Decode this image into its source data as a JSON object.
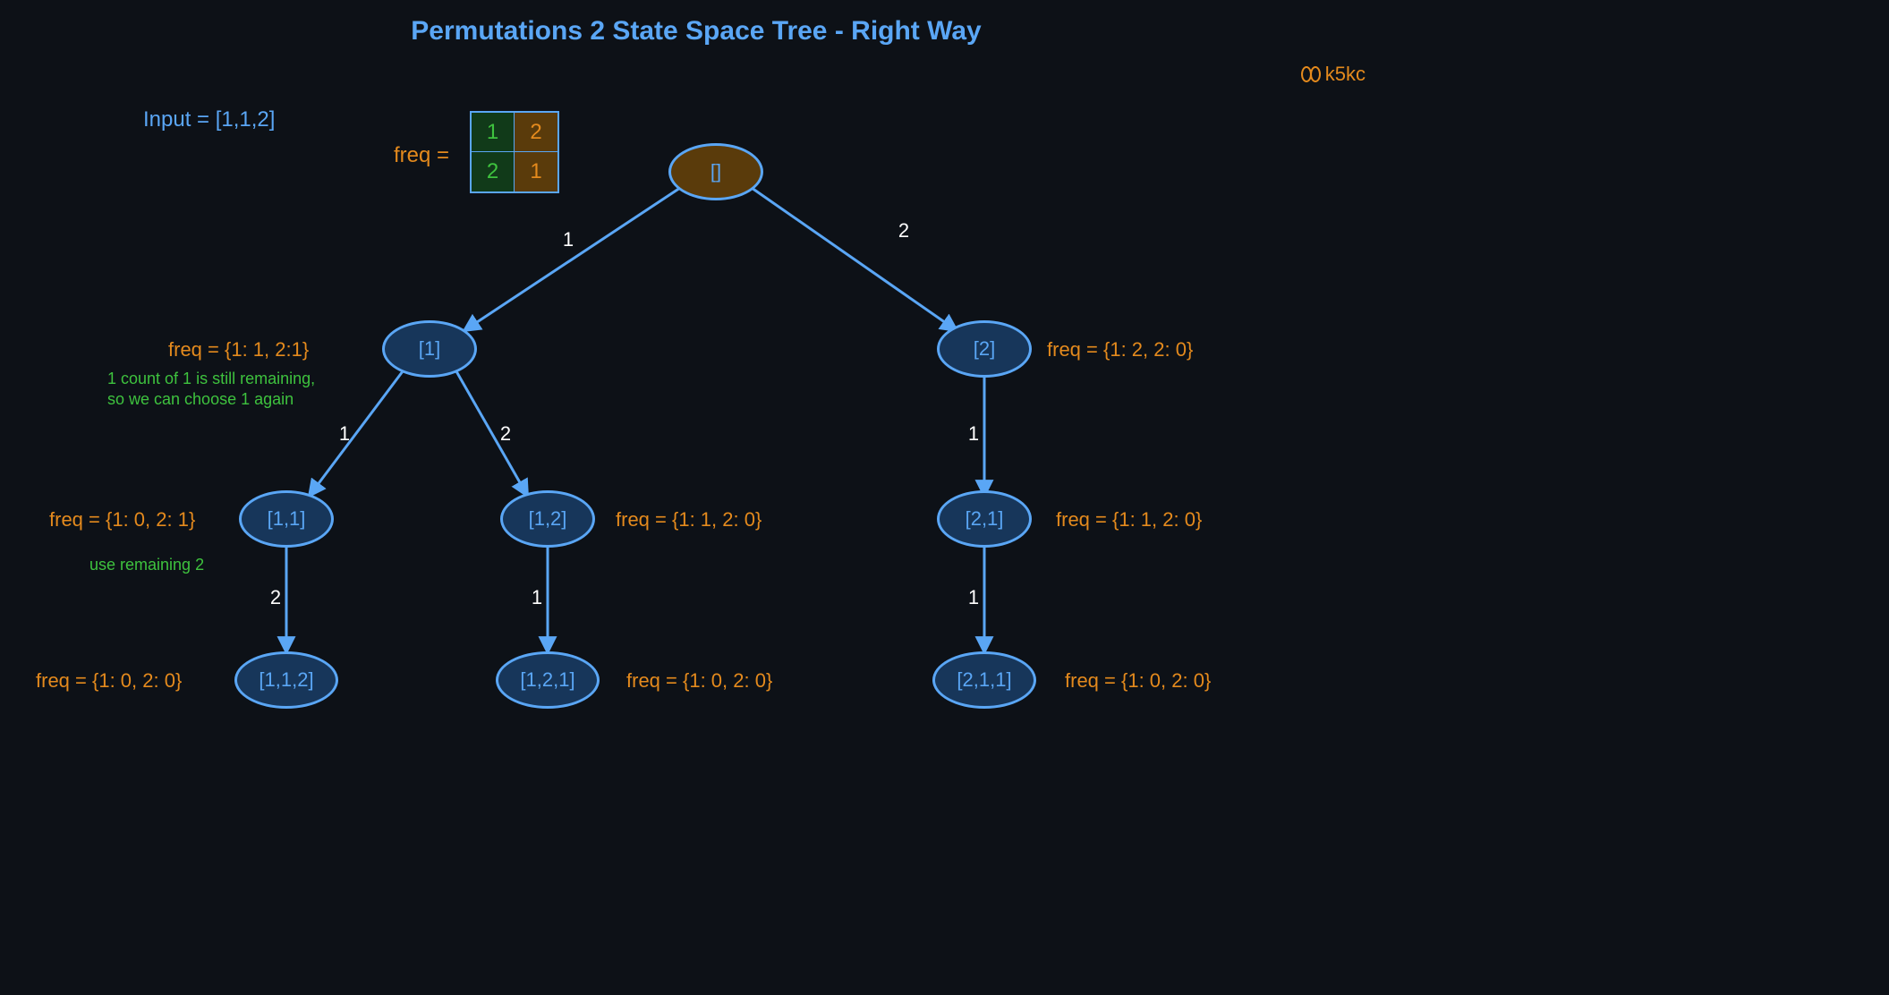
{
  "title": "Permutations 2 State Space Tree - Right Way",
  "watermark": "k5kc",
  "input_text": "Input = [1,1,2]",
  "freq_label": "freq =",
  "freq_table": {
    "tl": "1",
    "tr": "2",
    "bl": "2",
    "br": "1"
  },
  "nodes": {
    "root": {
      "label": "[]"
    },
    "n1": {
      "label": "[1]"
    },
    "n2": {
      "label": "[2]"
    },
    "n11": {
      "label": "[1,1]"
    },
    "n12": {
      "label": "[1,2]"
    },
    "n21": {
      "label": "[2,1]"
    },
    "n112": {
      "label": "[1,1,2]"
    },
    "n121": {
      "label": "[1,2,1]"
    },
    "n211": {
      "label": "[2,1,1]"
    }
  },
  "edges": {
    "root_n1": "1",
    "root_n2": "2",
    "n1_n11": "1",
    "n1_n12": "2",
    "n2_n21": "1",
    "n11_n112": "2",
    "n12_n121": "1",
    "n21_n211": "1"
  },
  "annotations": {
    "n1_freq": "freq = {1: 1, 2:1}",
    "n1_note": "1 count of 1 is still remaining,\nso we can choose 1 again",
    "n2_freq": "freq = {1: 2, 2: 0}",
    "n11_freq": "freq = {1: 0, 2: 1}",
    "n11_note": "use remaining 2",
    "n12_freq": "freq = {1: 1, 2: 0}",
    "n21_freq": "freq = {1: 1, 2: 0}",
    "n112_freq": "freq = {1: 0, 2: 0}",
    "n121_freq": "freq = {1: 0, 2: 0}",
    "n211_freq": "freq = {1: 0, 2: 0}"
  }
}
